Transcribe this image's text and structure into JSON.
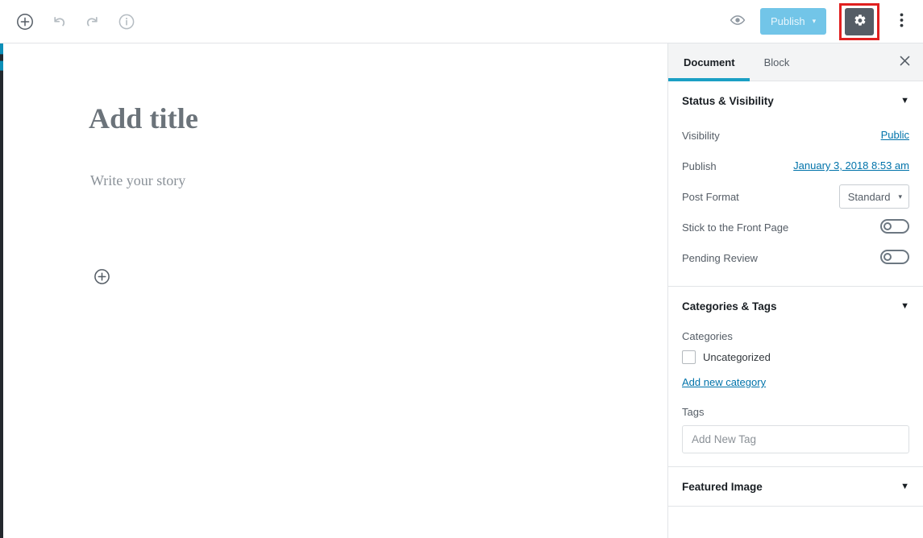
{
  "toolbar": {
    "add_block_label": "Add block",
    "undo_label": "Undo",
    "redo_label": "Redo",
    "info_label": "Content structure",
    "preview_label": "Preview",
    "publish_label": "Publish",
    "publish_caret": "▾",
    "settings_label": "Settings",
    "more_label": "More options",
    "icons": {
      "add": "plus-circle-icon",
      "undo": "undo-arrow-icon",
      "redo": "redo-arrow-icon",
      "info": "info-circle-icon",
      "preview": "eye-icon",
      "settings": "gear-icon",
      "more": "kebab-menu-icon"
    },
    "colors": {
      "publish_bg": "#72c5e8",
      "publish_text": "#e9f6fc",
      "settings_bg": "#555d66",
      "highlight_border": "#e02020"
    }
  },
  "editor": {
    "title_placeholder": "Add title",
    "body_placeholder": "Write your story",
    "inserter_label": "Add block"
  },
  "sidebar": {
    "tabs": [
      {
        "label": "Document",
        "active": true
      },
      {
        "label": "Block",
        "active": false
      }
    ],
    "close_label": "Close settings",
    "active_tab_color": "#1b9fc4",
    "panels": [
      {
        "title": "Status & Visibility",
        "chevron": "▼",
        "expanded": true,
        "rows": [
          {
            "label": "Visibility",
            "value": "Public",
            "type": "link"
          },
          {
            "label": "Publish",
            "value": "January 3, 2018 8:53 am",
            "type": "link"
          },
          {
            "label": "Post Format",
            "value": "Standard",
            "type": "select",
            "caret": "▾"
          },
          {
            "label": "Stick to the Front Page",
            "value": "off",
            "type": "toggle"
          },
          {
            "label": "Pending Review",
            "value": "off",
            "type": "toggle"
          }
        ]
      },
      {
        "title": "Categories & Tags",
        "chevron": "▼",
        "expanded": true,
        "categories_label": "Categories",
        "categories": [
          {
            "name": "Uncategorized",
            "checked": false
          }
        ],
        "add_category_label": "Add new category",
        "tags_label": "Tags",
        "tag_input_placeholder": "Add New Tag",
        "tag_input_value": ""
      },
      {
        "title": "Featured Image",
        "chevron": "▼",
        "expanded": false
      }
    ]
  }
}
